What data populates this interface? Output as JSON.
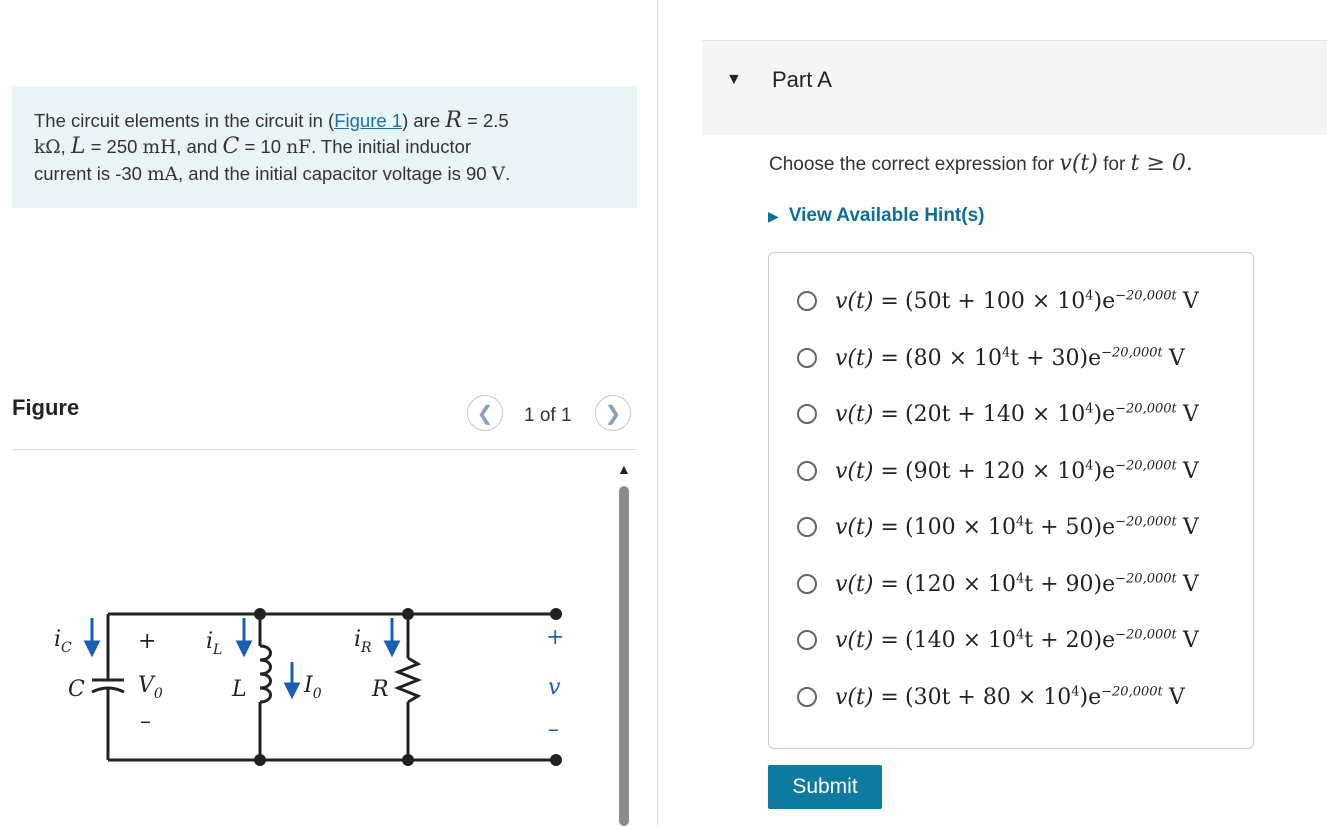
{
  "problem": {
    "intro": "The circuit elements in the circuit in (",
    "figure_link": "Figure 1",
    "after_link": ") are",
    "r_sym": "R",
    "r_val": "= 2.5",
    "k_ohm": "kΩ",
    "l_sym": "L",
    "l_val": "= 250",
    "mH": "mH",
    "and": ", and",
    "c_sym": "C",
    "c_val": "= 10",
    "nF": "nF",
    "sentence2": ". The initial inductor",
    "line3": "current is -30",
    "mA": "mA",
    "line3b": ", and the initial capacitor voltage is 90",
    "V": "V",
    "end": "."
  },
  "figure": {
    "title": "Figure",
    "page_indicator": "1 of 1",
    "prev_icon": "chevron-left-icon",
    "next_icon": "chevron-right-icon",
    "labels": {
      "ic": "i",
      "ic_sub": "C",
      "plus1": "+",
      "vo": "V",
      "vo_sub": "0",
      "minus1": "–",
      "c": "C",
      "il": "i",
      "il_sub": "L",
      "l": "L",
      "io": "I",
      "io_sub": "0",
      "ir": "i",
      "ir_sub": "R",
      "r": "R",
      "plus2": "+",
      "v": "v",
      "minus2": "–"
    }
  },
  "part": {
    "title": "Part A",
    "caret_icon": "triangle-down-icon"
  },
  "question": {
    "prompt_pre": "Choose the correct expression for",
    "prompt_math": "v(t)",
    "prompt_mid": "for",
    "prompt_cond": "t ≥ 0."
  },
  "hint": {
    "label": "View Available Hint(s)",
    "icon": "triangle-right-icon"
  },
  "options": [
    {
      "pre": "(50t + 100 × 10",
      "mid": "4",
      "post": ")e",
      "exp": "−20,000t",
      "unit": "V",
      "tpos": "a"
    },
    {
      "pre": "(80 × 10",
      "mid": "4",
      "post": "t + 30)e",
      "exp": "−20,000t",
      "unit": "V",
      "tpos": "b"
    },
    {
      "pre": "(20t + 140 × 10",
      "mid": "4",
      "post": ")e",
      "exp": "−20,000t",
      "unit": "V",
      "tpos": "a"
    },
    {
      "pre": "(90t + 120 × 10",
      "mid": "4",
      "post": ")e",
      "exp": "−20,000t",
      "unit": "V",
      "tpos": "a"
    },
    {
      "pre": "(100 × 10",
      "mid": "4",
      "post": "t + 50)e",
      "exp": "−20,000t",
      "unit": "V",
      "tpos": "b"
    },
    {
      "pre": "(120 × 10",
      "mid": "4",
      "post": "t + 90)e",
      "exp": "−20,000t",
      "unit": "V",
      "tpos": "b"
    },
    {
      "pre": "(140 × 10",
      "mid": "4",
      "post": "t + 20)e",
      "exp": "−20,000t",
      "unit": "V",
      "tpos": "b"
    },
    {
      "pre": "(30t + 80 × 10",
      "mid": "4",
      "post": ")e",
      "exp": "−20,000t",
      "unit": "V",
      "tpos": "a"
    }
  ],
  "option_lhs": "v(t) =",
  "submit": {
    "label": "Submit"
  },
  "colors": {
    "accent": "#0f7aa0",
    "link": "#1a6fa3",
    "problem_bg": "#e8f4f5"
  }
}
